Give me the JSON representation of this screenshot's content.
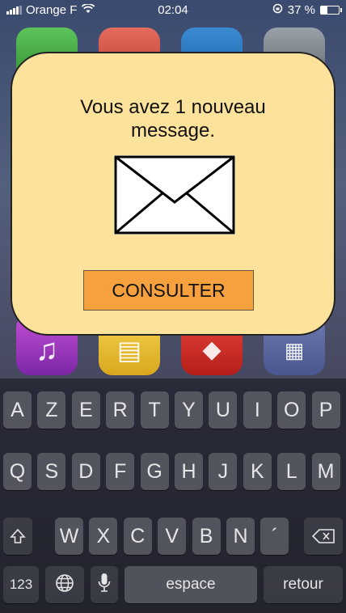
{
  "status_bar": {
    "carrier": "Orange F",
    "time": "02:04",
    "battery_percent": "37 %",
    "battery_level": 0.37,
    "icons": [
      "signal-icon",
      "wifi-icon",
      "rotation-lock-icon",
      "battery-icon"
    ]
  },
  "home_screen": {
    "app_icons": [
      "messages-icon",
      "calendar-icon",
      "photos-icon",
      "settings-icon",
      "music-icon",
      "notes-icon",
      "games-icon",
      "folder-icon"
    ]
  },
  "alert": {
    "message": "Vous avez 1 nouveau message.",
    "icon": "envelope-icon",
    "button_label": "CONSULTER",
    "background_color": "#fde29b",
    "button_color": "#f7a13e"
  },
  "keyboard": {
    "row1": [
      "A",
      "Z",
      "E",
      "R",
      "T",
      "Y",
      "U",
      "I",
      "O",
      "P"
    ],
    "row2": [
      "Q",
      "S",
      "D",
      "F",
      "G",
      "H",
      "J",
      "K",
      "L",
      "M"
    ],
    "row3": [
      "W",
      "X",
      "C",
      "V",
      "B",
      "N",
      "´"
    ],
    "numbers_label": "123",
    "space_label": "espace",
    "return_label": "retour"
  }
}
